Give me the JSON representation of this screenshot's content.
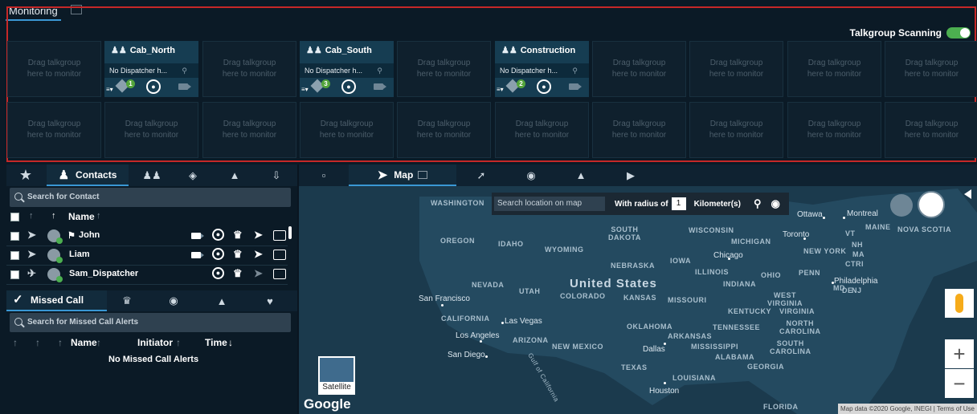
{
  "monitoring": {
    "tab_label": "Monitoring",
    "scan_label": "Talkgroup Scanning",
    "placeholder_text": "Drag talkgroup here to monitor",
    "talkgroups": [
      {
        "name": "Cab_North",
        "dispatcher": "No Dispatcher h...",
        "badge": "1"
      },
      {
        "name": "Cab_South",
        "dispatcher": "No Dispatcher h...",
        "badge": "3"
      },
      {
        "name": "Construction",
        "dispatcher": "No Dispatcher h...",
        "badge": "2"
      }
    ]
  },
  "left": {
    "contacts_tab": "Contacts",
    "search_placeholder": "Search for Contact",
    "name_header": "Name",
    "contacts": [
      {
        "name": "John"
      },
      {
        "name": "Liam"
      },
      {
        "name": "Sam_Dispatcher"
      }
    ],
    "mca_tab": "Missed Call Alerts",
    "mca_search": "Search for Missed Call Alerts",
    "mca_cols": {
      "name": "Name",
      "initiator": "Initiator",
      "time": "Time"
    },
    "mca_empty": "No Missed Call Alerts"
  },
  "map": {
    "tab_label": "Map",
    "search_placeholder": "Search location on map",
    "radius_label": "With radius of",
    "radius_value": "1",
    "radius_unit": "Kilometer(s)",
    "satellite_label": "Satellite",
    "google": "Google",
    "attribution": "Map data ©2020 Google, INEGI | Terms of Use",
    "country": "United States",
    "states": [
      "WASHINGTON",
      "OREGON",
      "IDAHO",
      "WYOMING",
      "SOUTH DAKOTA",
      "NEBRASKA",
      "IOWA",
      "WISCONSIN",
      "MICHIGAN",
      "ILLINOIS",
      "INDIANA",
      "OHIO",
      "PENN",
      "NEVADA",
      "UTAH",
      "COLORADO",
      "KANSAS",
      "MISSOURI",
      "KENTUCKY",
      "WEST VIRGINIA",
      "VIRGINIA",
      "CALIFORNIA",
      "ARIZONA",
      "NEW MEXICO",
      "OKLAHOMA",
      "ARKANSAS",
      "TENNESSEE",
      "NORTH CAROLINA",
      "MISSISSIPPI",
      "SOUTH CAROLINA",
      "ALABAMA",
      "GEORGIA",
      "TEXAS",
      "LOUISIANA",
      "FLORIDA",
      "MAINE",
      "VT",
      "NH",
      "MA",
      "CTRI",
      "MD",
      "DE",
      "NJ",
      "NEW YORK",
      "NOVA SCOTIA",
      "Gulf of California"
    ],
    "cities": [
      "Ottawa",
      "Montreal",
      "Toronto",
      "Chicago",
      "Philadelphia",
      "San Francisco",
      "Las Vegas",
      "Los Angeles",
      "San Diego",
      "Dallas",
      "Houston"
    ]
  },
  "colors": {
    "accent": "#3a97d4",
    "toggle_on": "#4caf50",
    "highlight_border": "#c62828",
    "talkgroup_bg": "#163d52"
  }
}
